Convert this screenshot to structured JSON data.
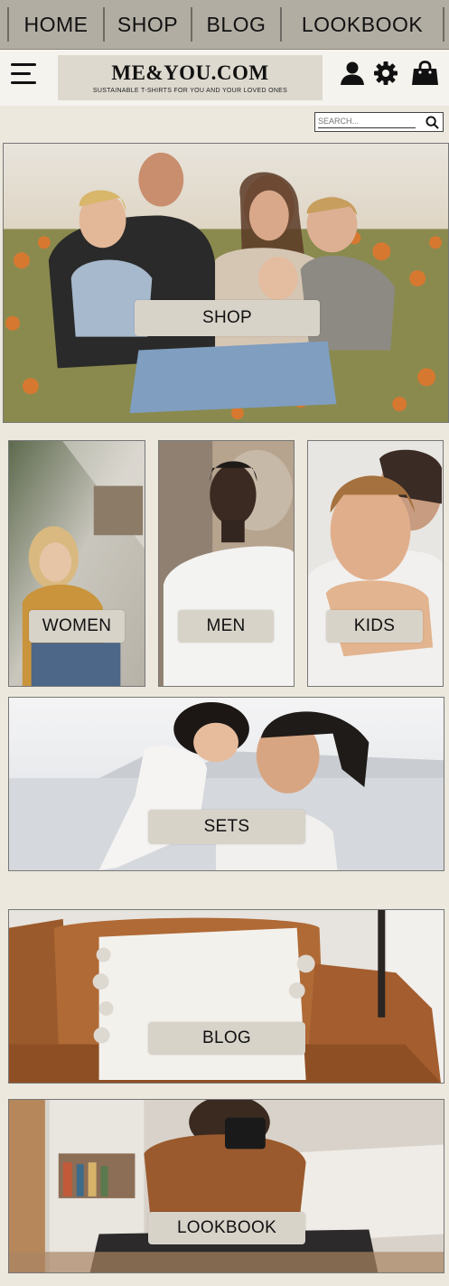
{
  "nav": {
    "items": [
      {
        "label": "HOME"
      },
      {
        "label": "SHOP"
      },
      {
        "label": "BLOG"
      },
      {
        "label": "LOOKBOOK"
      }
    ]
  },
  "header": {
    "menu_icon": "hamburger-icon",
    "logo_title": "ME&YOU.COM",
    "logo_tagline": "SUSTAINABLE T-SHIRTS FOR YOU AND YOUR LOVED ONES",
    "icons": [
      "user-icon",
      "gear-icon",
      "shopping-bag-icon"
    ]
  },
  "search": {
    "placeholder": "SEARCH...",
    "icon": "search-icon"
  },
  "hero": {
    "button_label": "SHOP"
  },
  "categories": [
    {
      "label": "WOMEN"
    },
    {
      "label": "MEN"
    },
    {
      "label": "KIDS"
    }
  ],
  "sets": {
    "label": "SETS"
  },
  "blog": {
    "label": "BLOG"
  },
  "lookbook": {
    "label": "LOOKBOOK"
  },
  "colors": {
    "page_bg": "#ece8dd",
    "nav_bg": "#b2ada3",
    "button_bg": "#d8d3c9"
  }
}
